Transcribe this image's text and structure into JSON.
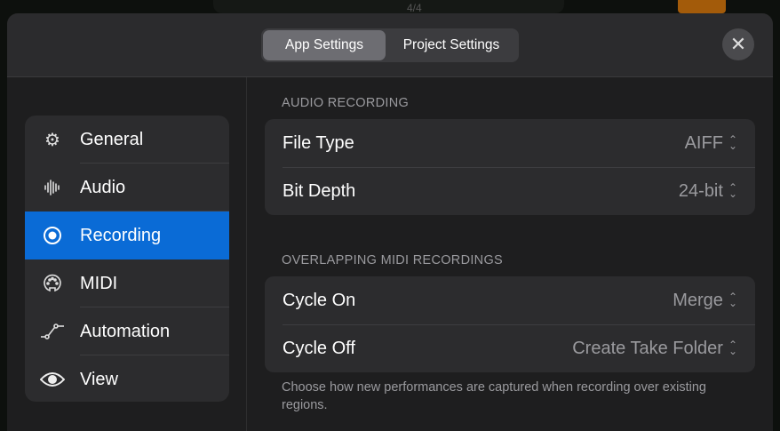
{
  "background": {
    "time_signature": "4/4"
  },
  "header": {
    "tabs": [
      {
        "label": "App Settings"
      },
      {
        "label": "Project Settings"
      }
    ],
    "close_label": "✕"
  },
  "sidebar": {
    "items": [
      {
        "label": "General",
        "icon": "⚙"
      },
      {
        "label": "Audio",
        "icon": "𝍪"
      },
      {
        "label": "Recording",
        "icon": "◉"
      },
      {
        "label": "MIDI",
        "icon": "☺"
      },
      {
        "label": "Automation",
        "icon": "⟋"
      },
      {
        "label": "View",
        "icon": "👁"
      }
    ]
  },
  "audio_recording": {
    "title": "AUDIO RECORDING",
    "rows": [
      {
        "label": "File Type",
        "value": "AIFF"
      },
      {
        "label": "Bit Depth",
        "value": "24-bit"
      }
    ]
  },
  "midi_recordings": {
    "title": "OVERLAPPING MIDI RECORDINGS",
    "rows": [
      {
        "label": "Cycle On",
        "value": "Merge"
      },
      {
        "label": "Cycle Off",
        "value": "Create Take Folder"
      }
    ],
    "note": "Choose how new performances are captured when recording over existing regions."
  },
  "colors": {
    "accent": "#0a6bd6"
  }
}
